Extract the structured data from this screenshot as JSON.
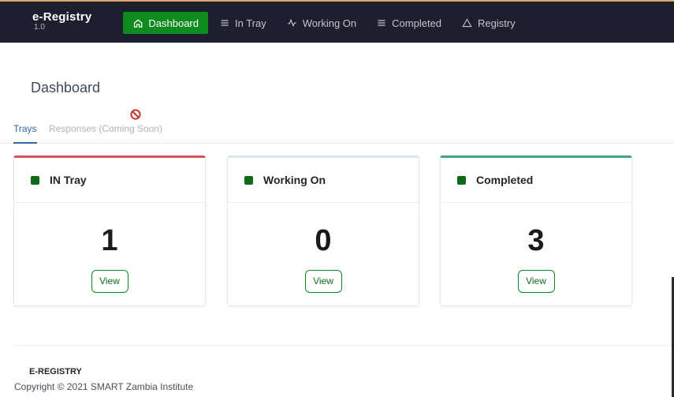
{
  "brand": {
    "name": "e-Registry",
    "version": "1.0"
  },
  "nav": {
    "items": [
      {
        "label": "Dashboard",
        "icon": "home-icon",
        "active": true
      },
      {
        "label": "In Tray",
        "icon": "list-icon"
      },
      {
        "label": "Working On",
        "icon": "activity-icon"
      },
      {
        "label": "Completed",
        "icon": "list-icon"
      },
      {
        "label": "Registry",
        "icon": "triangle-icon"
      }
    ]
  },
  "page": {
    "title": "Dashboard"
  },
  "tabs": [
    {
      "label": "Trays",
      "active": true
    },
    {
      "label": "Responses (Coming Soon)",
      "disabled": true,
      "icon": "ban-icon"
    }
  ],
  "cards": [
    {
      "title": "IN Tray",
      "count": "1",
      "button": "View",
      "accent": "#d9534f"
    },
    {
      "title": "Working On",
      "count": "0",
      "button": "View",
      "accent": "#dfe6ea"
    },
    {
      "title": "Completed",
      "count": "3",
      "button": "View",
      "accent": "#3aa981"
    }
  ],
  "footer": {
    "brand": "E-REGISTRY",
    "copyright": "Copyright © 2021 SMART Zambia Institute"
  },
  "colors": {
    "primary": "#0f8a1e",
    "navbar": "#1b1f2e",
    "status_dot": "#0a6a18"
  }
}
